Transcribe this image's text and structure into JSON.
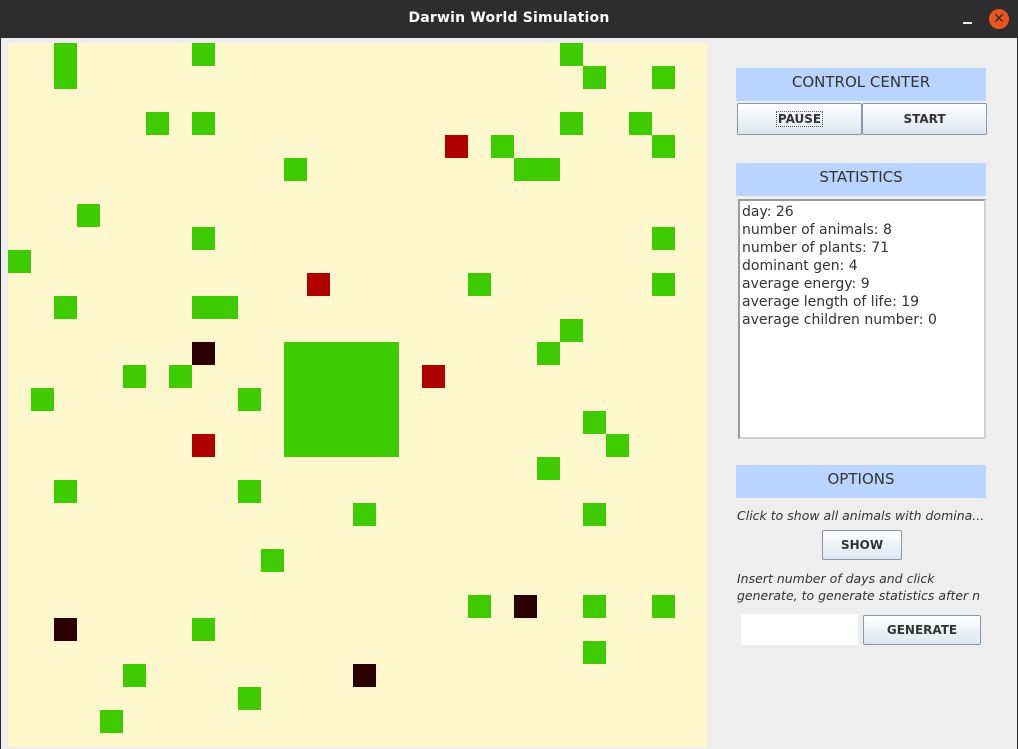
{
  "window": {
    "title": "Darwin World Simulation",
    "minimize_glyph": "—",
    "close_glyph": "✕"
  },
  "colors": {
    "plant": "#3ecc00",
    "animal_strong": "#b00000",
    "animal_weak": "#2a0000",
    "map_background": "#fff8cc",
    "header": "#b8d4ff"
  },
  "control": {
    "header": "CONTROL CENTER",
    "pause_label": "PAUSE",
    "start_label": "START"
  },
  "statistics": {
    "header": "STATISTICS",
    "day": "day: 26",
    "animals": "number of animals: 8",
    "plants": "number of plants: 71",
    "dominant_gen": "dominant gen: 4",
    "avg_energy": "average energy: 9",
    "avg_life": "average length of life: 19",
    "avg_children": "average children number: 0"
  },
  "options": {
    "header": "OPTIONS",
    "show_hint": "Click to show all animals with domina...",
    "show_label": "SHOW",
    "generate_hint_line1": "Insert number of days and click",
    "generate_hint_line2": "generate, to generate statistics after n",
    "days_value": "",
    "generate_label": "GENERATE"
  }
}
